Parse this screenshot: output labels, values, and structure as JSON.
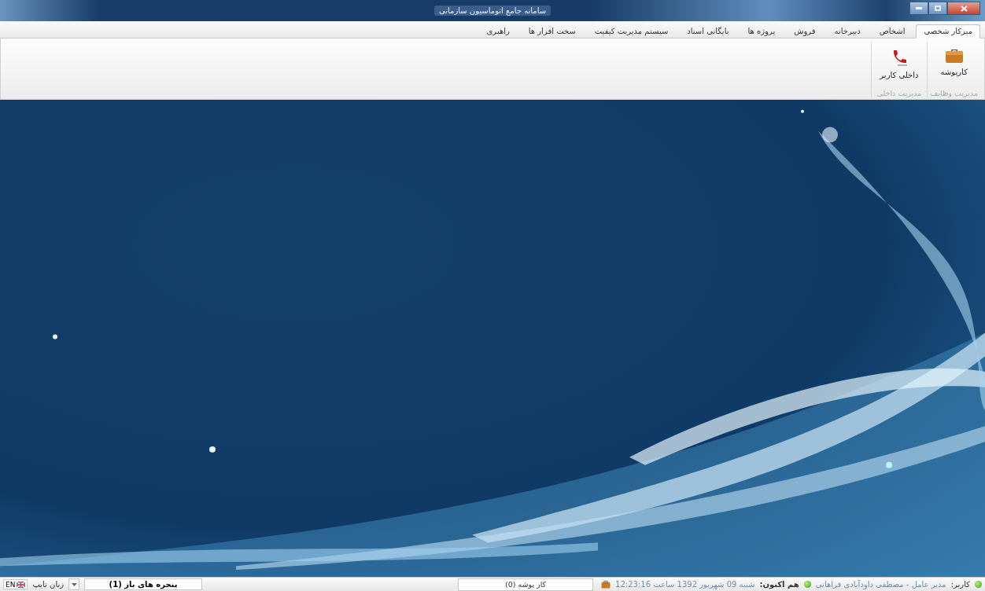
{
  "window": {
    "title": "سامانه جامع اتوماسیون سازمانی"
  },
  "tabs": [
    {
      "label": "میزکار شخصی",
      "selected": true
    },
    {
      "label": "اشخاص",
      "selected": false
    },
    {
      "label": "دبیرخانه",
      "selected": false
    },
    {
      "label": "فروش",
      "selected": false
    },
    {
      "label": "پروژه ها",
      "selected": false
    },
    {
      "label": "بایگانی اسناد",
      "selected": false
    },
    {
      "label": "سیستم مدیریت کیفیت",
      "selected": false
    },
    {
      "label": "سخت افزار ها",
      "selected": false
    },
    {
      "label": "راهبری",
      "selected": false
    }
  ],
  "ribbon": {
    "groups": [
      {
        "caption": "مدیریت وظایف",
        "buttons": [
          {
            "label": "کارپوشه",
            "kind": "briefcase"
          }
        ]
      },
      {
        "caption": "مدیریت داخلی",
        "buttons": [
          {
            "label": "داخلی کاربر",
            "kind": "phone"
          }
        ]
      }
    ]
  },
  "status_bar": {
    "user_label": "کاربر:",
    "user": "مدیر عامل - مصطفی داودآبادی فراهانی",
    "now_label": "هم اکنون:",
    "now": "شنبه 09 شهریور 1392 ساعت 12:23:16",
    "inbox": "کار پوشه (0)",
    "open_windows": "پنجره های باز (1)",
    "typing_language_label": "زبان تایپ",
    "typing_language": "EN"
  }
}
